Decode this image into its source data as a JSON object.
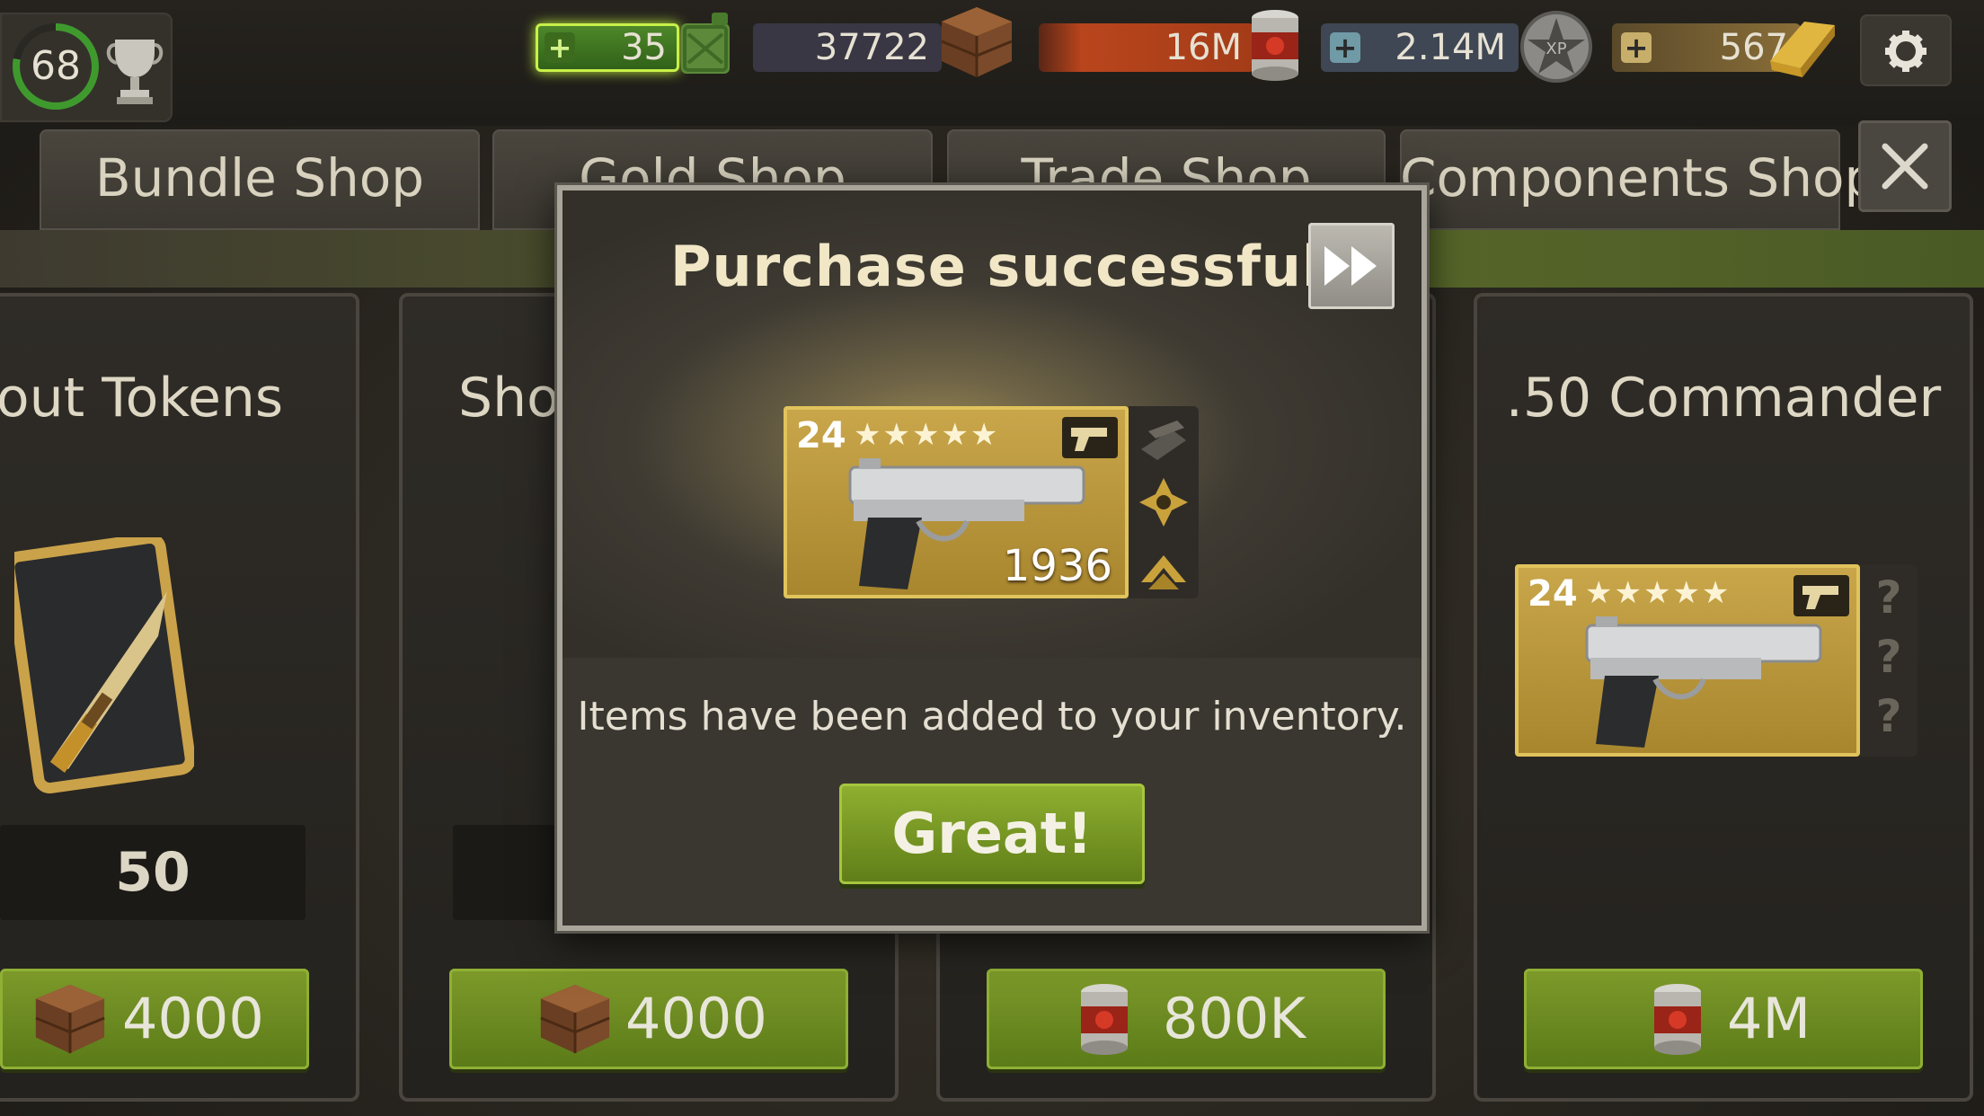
{
  "topbar": {
    "level": "68",
    "fuel": "35",
    "supplies": "37722",
    "food": "16M",
    "xp": "2.14M",
    "gold": "567",
    "icons": {
      "trophy": "trophy-icon",
      "fuel": "fuel-can-icon",
      "supplies": "crate-icon",
      "food": "food-can-icon",
      "xp": "xp-badge-icon",
      "gold": "gold-bar-icon",
      "settings": "gear-icon"
    }
  },
  "tabs": [
    {
      "label": "Bundle Shop"
    },
    {
      "label": "Gold Shop"
    },
    {
      "label": "Trade Shop"
    },
    {
      "label": "Components Shop"
    }
  ],
  "cards": [
    {
      "title": "Scout Tokens",
      "count": "50",
      "price": "4000",
      "currency": "crate-icon"
    },
    {
      "title": "Shotgun",
      "price": "4000",
      "currency": "crate-icon"
    },
    {
      "title": "",
      "price": "800K",
      "currency": "food-can-icon"
    },
    {
      "title": ".50 Commander",
      "price": "4M",
      "currency": "food-can-icon",
      "weapon": {
        "level": "24",
        "stars": "★★★★★",
        "unknown_perks": [
          "?",
          "?",
          "?"
        ]
      }
    }
  ],
  "modal": {
    "title": "Purchase successful!",
    "weapon": {
      "level": "24",
      "stars": "★★★★★",
      "power": "1936"
    },
    "message": "Items have been added to your inventory.",
    "confirm_label": "Great!"
  },
  "colors": {
    "accent_green": "#7d9a2a",
    "gold_tile": "#c9a64a",
    "modal_border": "#a9a59a"
  }
}
